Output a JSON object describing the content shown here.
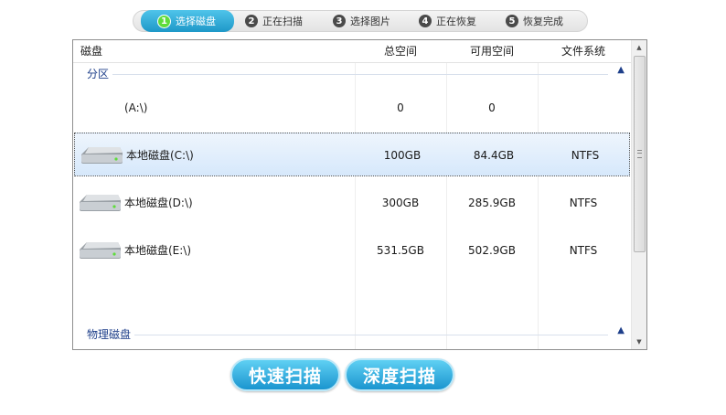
{
  "steps": [
    {
      "num": "1",
      "label": "选择磁盘",
      "active": true
    },
    {
      "num": "2",
      "label": "正在扫描"
    },
    {
      "num": "3",
      "label": "选择图片"
    },
    {
      "num": "4",
      "label": "正在恢复"
    },
    {
      "num": "5",
      "label": "恢复完成"
    }
  ],
  "table": {
    "headers": [
      "磁盘",
      "总空间",
      "可用空间",
      "文件系统"
    ],
    "groups": {
      "partition": "分区",
      "physical": "物理磁盘"
    },
    "rows": [
      {
        "name": "(A:\\)",
        "total": "0",
        "free": "0",
        "fs": "",
        "icon": "none"
      },
      {
        "name": "本地磁盘(C:\\)",
        "total": "100GB",
        "free": "84.4GB",
        "fs": "NTFS",
        "icon": "hard-drive-icon",
        "selected": true
      },
      {
        "name": "本地磁盘(D:\\)",
        "total": "300GB",
        "free": "285.9GB",
        "fs": "NTFS",
        "icon": "hard-drive-icon"
      },
      {
        "name": "本地磁盘(E:\\)",
        "total": "531.5GB",
        "free": "502.9GB",
        "fs": "NTFS",
        "icon": "hard-drive-icon"
      }
    ]
  },
  "buttons": {
    "quick_scan": "快速扫描",
    "deep_scan": "深度扫描"
  },
  "colors": {
    "accent": "#1e98c8",
    "group_label": "#1e3f8a",
    "step_active_num": "#5fdc3c"
  }
}
